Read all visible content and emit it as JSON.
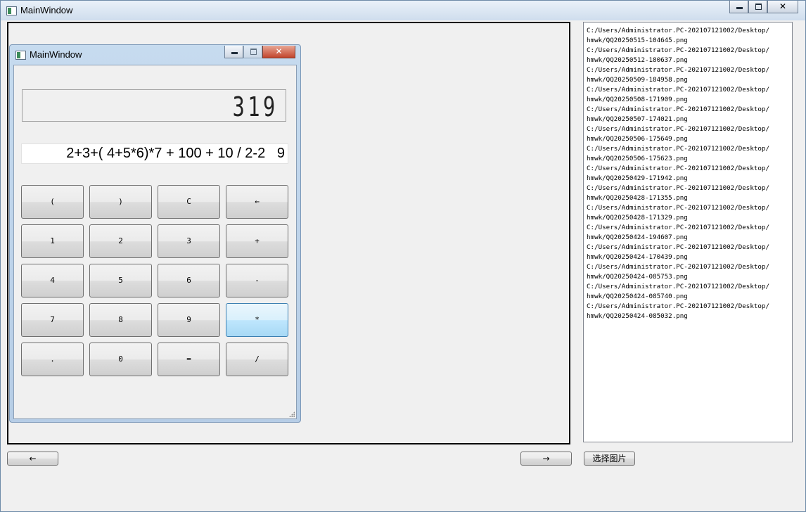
{
  "window": {
    "title": "MainWindow"
  },
  "calculator": {
    "title": "MainWindow",
    "display": "319",
    "expression": "2+3+( 4+5*6)*7 + 100 + 10 / 2-2   9",
    "keys": [
      [
        "(",
        ")",
        "C",
        "←"
      ],
      [
        "1",
        "2",
        "3",
        "+"
      ],
      [
        "4",
        "5",
        "6",
        "-"
      ],
      [
        "7",
        "8",
        "9",
        "*"
      ],
      [
        ".",
        "0",
        "=",
        "/"
      ]
    ]
  },
  "file_list": [
    "C:/Users/Administrator.PC-202107121002/Desktop/",
    "hmwk/QQ20250515-104645.png",
    "C:/Users/Administrator.PC-202107121002/Desktop/",
    "hmwk/QQ20250512-180637.png",
    "C:/Users/Administrator.PC-202107121002/Desktop/",
    "hmwk/QQ20250509-184958.png",
    "C:/Users/Administrator.PC-202107121002/Desktop/",
    "hmwk/QQ20250508-171909.png",
    "C:/Users/Administrator.PC-202107121002/Desktop/",
    "hmwk/QQ20250507-174021.png",
    "C:/Users/Administrator.PC-202107121002/Desktop/",
    "hmwk/QQ20250506-175649.png",
    "C:/Users/Administrator.PC-202107121002/Desktop/",
    "hmwk/QQ20250506-175623.png",
    "C:/Users/Administrator.PC-202107121002/Desktop/",
    "hmwk/QQ20250429-171942.png",
    "C:/Users/Administrator.PC-202107121002/Desktop/",
    "hmwk/QQ20250428-171355.png",
    "C:/Users/Administrator.PC-202107121002/Desktop/",
    "hmwk/QQ20250428-171329.png",
    "C:/Users/Administrator.PC-202107121002/Desktop/",
    "hmwk/QQ20250424-194607.png",
    "C:/Users/Administrator.PC-202107121002/Desktop/",
    "hmwk/QQ20250424-170439.png",
    "C:/Users/Administrator.PC-202107121002/Desktop/",
    "hmwk/QQ20250424-085753.png",
    "C:/Users/Administrator.PC-202107121002/Desktop/",
    "hmwk/QQ20250424-085740.png",
    "C:/Users/Administrator.PC-202107121002/Desktop/",
    "hmwk/QQ20250424-085032.png"
  ],
  "nav": {
    "prev": "←",
    "next": "→",
    "select": "选择图片"
  },
  "window_controls": {
    "close_glyph": "✕"
  },
  "icons": {
    "app": "app-window-icon"
  }
}
